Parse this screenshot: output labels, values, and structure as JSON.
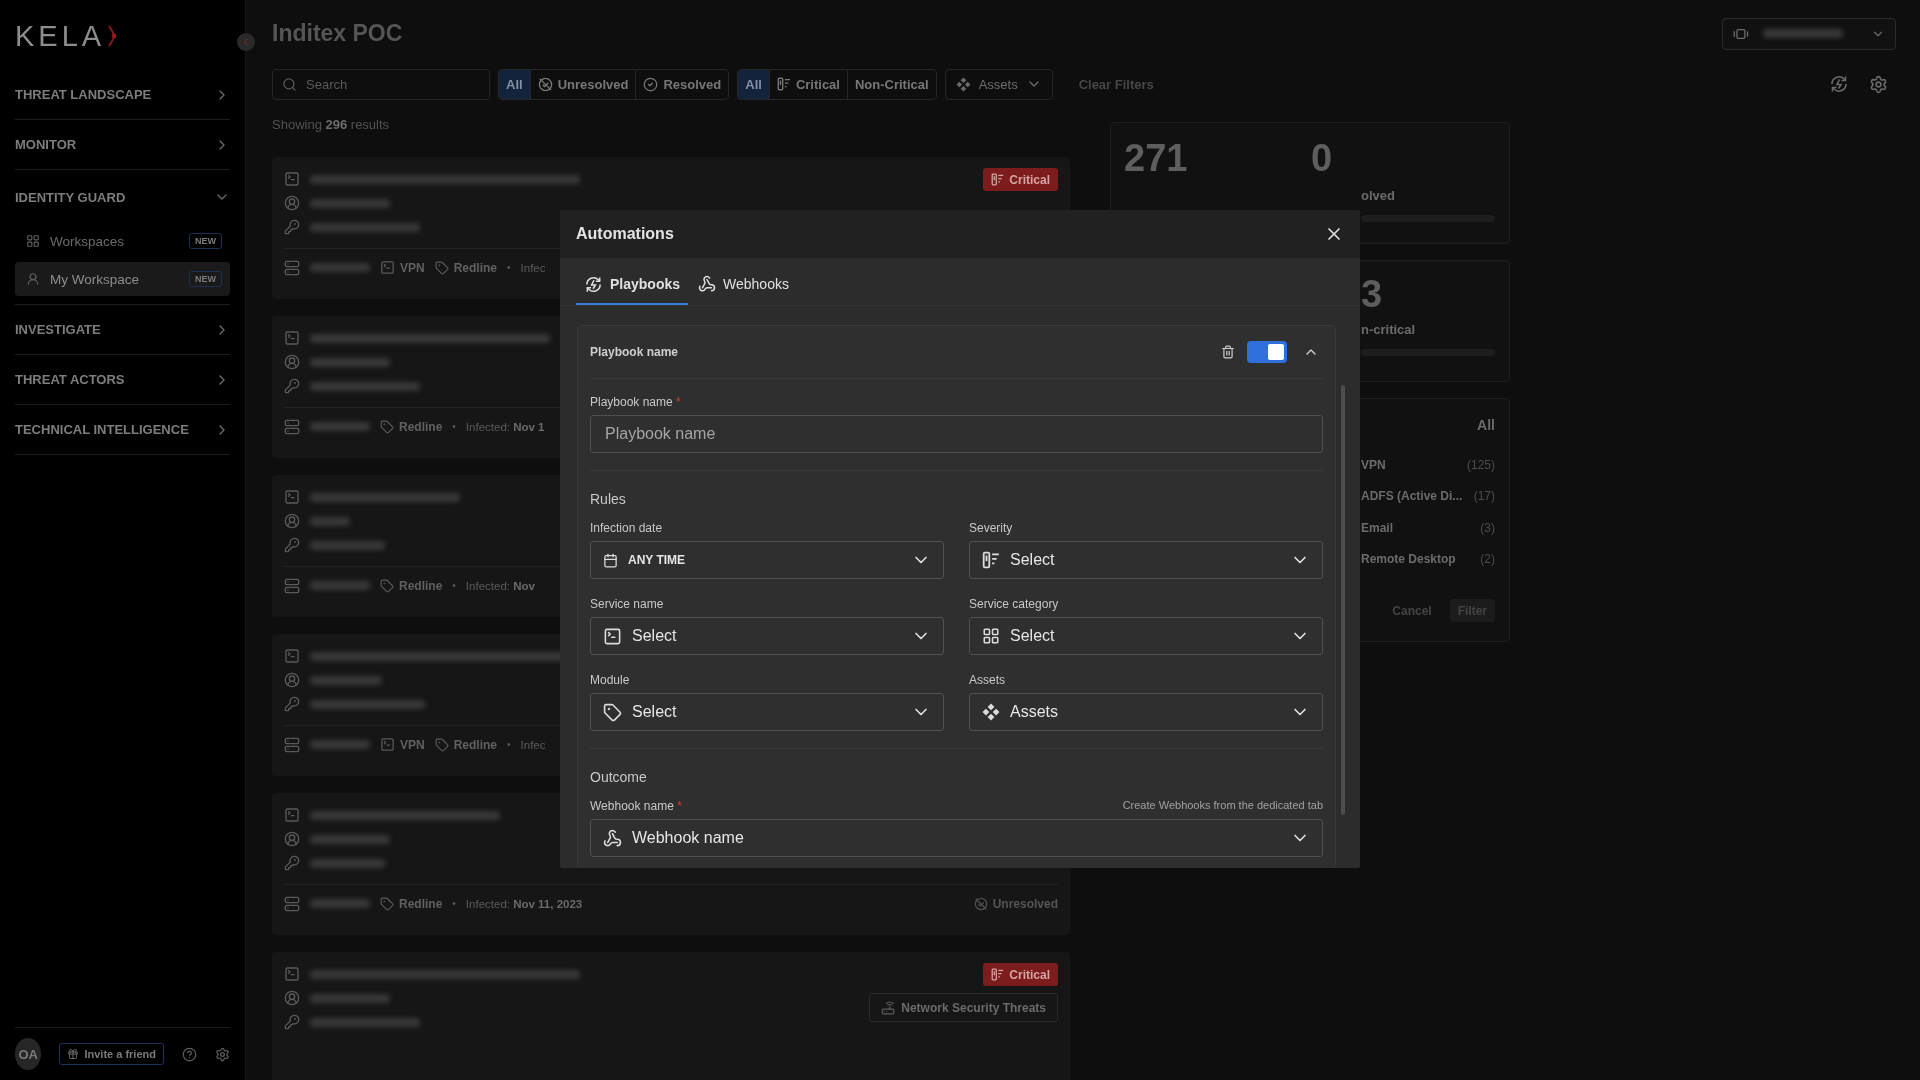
{
  "sidebar": {
    "logo": "KELA",
    "nav": [
      {
        "label": "THREAT LANDSCAPE",
        "expanded": false
      },
      {
        "label": "MONITOR",
        "expanded": false
      },
      {
        "label": "IDENTITY GUARD",
        "expanded": true,
        "children": [
          {
            "label": "Workspaces",
            "badge": "NEW",
            "selected": false
          },
          {
            "label": "My Workspace",
            "badge": "NEW",
            "selected": true
          }
        ]
      },
      {
        "label": "INVESTIGATE",
        "expanded": false
      },
      {
        "label": "THREAT ACTORS",
        "expanded": false
      },
      {
        "label": "TECHNICAL INTELLIGENCE",
        "expanded": false
      }
    ],
    "footer": {
      "avatar": "OA",
      "invite": "Invite a friend"
    }
  },
  "header": {
    "title": "Inditex POC"
  },
  "filters": {
    "search_placeholder": "Search",
    "status": [
      {
        "label": "All",
        "kind": "all",
        "selected": true
      },
      {
        "label": "Unresolved",
        "kind": "unresolved",
        "selected": false
      },
      {
        "label": "Resolved",
        "kind": "resolved",
        "selected": false
      }
    ],
    "severity": [
      {
        "label": "All",
        "kind": "all",
        "selected": true
      },
      {
        "label": "Critical",
        "kind": "critical",
        "selected": false
      },
      {
        "label": "Non-Critical",
        "kind": "noncritical",
        "selected": false
      }
    ],
    "assets": "Assets",
    "clear": "Clear Filters"
  },
  "results": "Showing **296** results",
  "cards": [
    {
      "severity": "Critical",
      "service": "VPN",
      "module": "Redline",
      "separator": "•",
      "infected": "Infec"
    },
    {
      "module": "Redline",
      "separator": "•",
      "infected": "Infected: **Nov 1**"
    },
    {
      "module": "Redline",
      "separator": "•",
      "infected": "Infected: **Nov**"
    },
    {
      "service": "VPN",
      "module": "Redline",
      "separator": "•",
      "infected": "Infec"
    },
    {
      "module": "Redline",
      "separator": "•",
      "infected": "Infected: **Nov 11, 2023**",
      "status": "Unresolved"
    },
    {
      "severity": "Critical",
      "category": "Network Security Threats"
    }
  ],
  "stats": {
    "counts": [
      {
        "value": "271"
      },
      {
        "value": "0",
        "label": "olved"
      }
    ],
    "noncritical": {
      "value": "3",
      "label": "n-critical"
    },
    "services": {
      "all": "All",
      "rows": [
        {
          "name": "VPN",
          "count": "(125)"
        },
        {
          "name": "ADFS (Active Di...",
          "count": "(17)"
        },
        {
          "name": "Email",
          "count": "(3)"
        },
        {
          "name": "Remote Desktop",
          "count": "(2)"
        }
      ],
      "cancel": "Cancel",
      "filter": "Filter"
    }
  },
  "modal": {
    "title": "Automations",
    "tabs": [
      {
        "label": "Playbooks",
        "selected": true
      },
      {
        "label": "Webhooks",
        "selected": false
      }
    ],
    "playbook": {
      "header": "Playbook name",
      "enabled": true,
      "expanded": true,
      "name_label": "Playbook name",
      "required": "*",
      "name_placeholder": "Playbook name",
      "rules_title": "Rules",
      "rules": [
        {
          "label": "Infection date",
          "value": "ANY TIME",
          "kind": "date"
        },
        {
          "label": "Severity",
          "value": "Select",
          "kind": "severity"
        },
        {
          "label": "Service name",
          "value": "Select",
          "kind": "service"
        },
        {
          "label": "Service category",
          "value": "Select",
          "kind": "category"
        },
        {
          "label": "Module",
          "value": "Select",
          "kind": "module"
        },
        {
          "label": "Assets",
          "value": "Assets",
          "kind": "assets"
        }
      ],
      "outcome_title": "Outcome",
      "webhook_label": "Webhook name",
      "webhook_required": "*",
      "webhook_hint": "Create Webhooks from the dedicated tab",
      "webhook_placeholder": "Webhook name"
    }
  }
}
